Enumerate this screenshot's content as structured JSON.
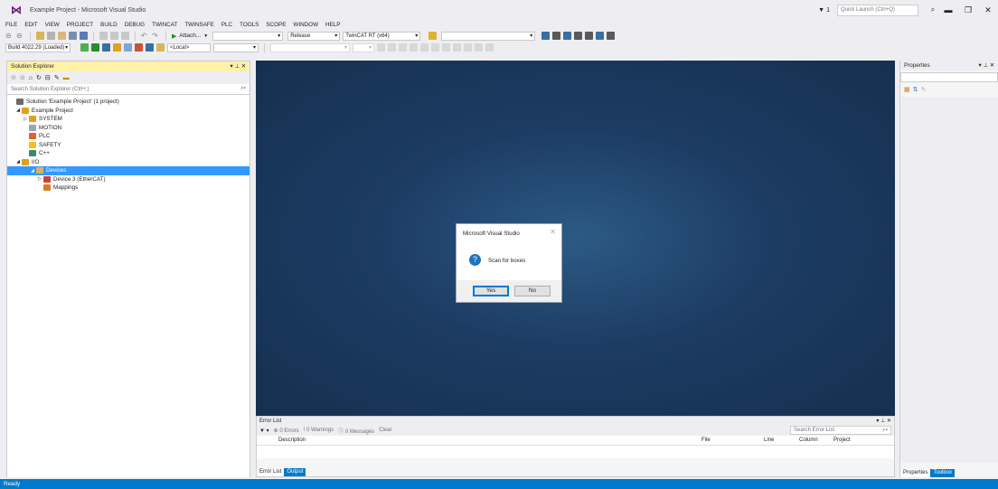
{
  "window": {
    "title": "Example Project - Microsoft Visual Studio",
    "notification_count": "1",
    "quick_launch_placeholder": "Quick Launch (Ctrl+Q)"
  },
  "menu": [
    "FILE",
    "EDIT",
    "VIEW",
    "PROJECT",
    "BUILD",
    "DEBUG",
    "TWINCAT",
    "TWINSAFE",
    "PLC",
    "TOOLS",
    "SCOPE",
    "WINDOW",
    "HELP"
  ],
  "toolbar": {
    "attach_label": "Attach...",
    "configuration": "Release",
    "platform": "TwinCAT RT (x64)",
    "build_version": "Build 4022.29 (Loaded)",
    "target": "<Local>"
  },
  "solution_explorer": {
    "title": "Solution Explorer",
    "search_placeholder": "Search Solution Explorer (Ctrl+;)",
    "items": [
      {
        "label": "Solution 'Example Project' (1 project)",
        "icon": "solution-icon"
      },
      {
        "label": "Example Project",
        "icon": "project-icon"
      },
      {
        "label": "SYSTEM",
        "icon": "system-icon"
      },
      {
        "label": "MOTION",
        "icon": "motion-icon"
      },
      {
        "label": "PLC",
        "icon": "plc-icon"
      },
      {
        "label": "SAFETY",
        "icon": "safety-icon"
      },
      {
        "label": "C++",
        "icon": "cpp-icon"
      },
      {
        "label": "I/O",
        "icon": "io-icon"
      },
      {
        "label": "Devices",
        "icon": "devices-icon"
      },
      {
        "label": "Device 3 (EtherCAT)",
        "icon": "ethercat-device-icon"
      },
      {
        "label": "Mappings",
        "icon": "mappings-icon"
      }
    ]
  },
  "dialog": {
    "title": "Microsoft Visual Studio",
    "message": "Scan for boxes",
    "yes_label": "Yes",
    "no_label": "No"
  },
  "error_list": {
    "title": "Error List",
    "errors": "0 Errors",
    "warnings": "0 Warnings",
    "messages": "0 Messages",
    "clear": "Clear",
    "search_placeholder": "Search Error List",
    "columns": [
      "Description",
      "File",
      "Line",
      "Column",
      "Project"
    ],
    "tabs": [
      "Error List",
      "Output"
    ]
  },
  "properties": {
    "title": "Properties",
    "tabs": [
      "Properties",
      "Toolbox"
    ]
  },
  "status": {
    "text": "Ready"
  },
  "colors": {
    "accent": "#007acc",
    "selection": "#3399ff",
    "active_tab_header": "#fff2a8",
    "editor_background": "#1c3b63"
  }
}
